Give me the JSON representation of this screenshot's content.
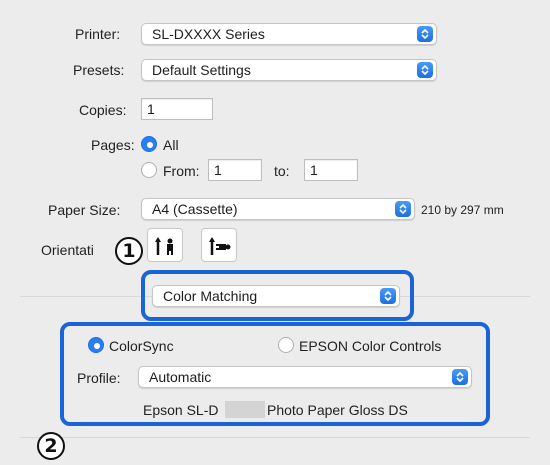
{
  "printer": {
    "label": "Printer:",
    "value": "SL-DXXXX Series"
  },
  "presets": {
    "label": "Presets:",
    "value": "Default Settings"
  },
  "copies": {
    "label": "Copies:",
    "value": "1"
  },
  "pages": {
    "label": "Pages:",
    "all_label": "All",
    "from_label": "From:",
    "from_value": "1",
    "to_label": "to:",
    "to_value": "1",
    "selected": "All"
  },
  "paper_size": {
    "label": "Paper Size:",
    "value": "A4 (Cassette)",
    "dimensions": "210 by 297 mm"
  },
  "orientation": {
    "label": "Orientati",
    "options": [
      "portrait",
      "landscape"
    ]
  },
  "panel": {
    "value": "Color Matching"
  },
  "color_matching": {
    "colorsync_label": "ColorSync",
    "epson_label": "EPSON Color Controls",
    "selected": "ColorSync",
    "profile_label": "Profile:",
    "profile_value": "Automatic",
    "profile_name_left": "Epson SL-D",
    "profile_name_right": "Photo Paper Gloss DS"
  },
  "callouts": {
    "one": "1",
    "two": "2"
  },
  "colors": {
    "accent": "#2a7ef4",
    "callout": "#1a63d8",
    "background": "#ececec"
  },
  "icons": [
    "popup-stepper-icon",
    "radio-icon",
    "portrait-person-icon",
    "landscape-person-icon"
  ]
}
